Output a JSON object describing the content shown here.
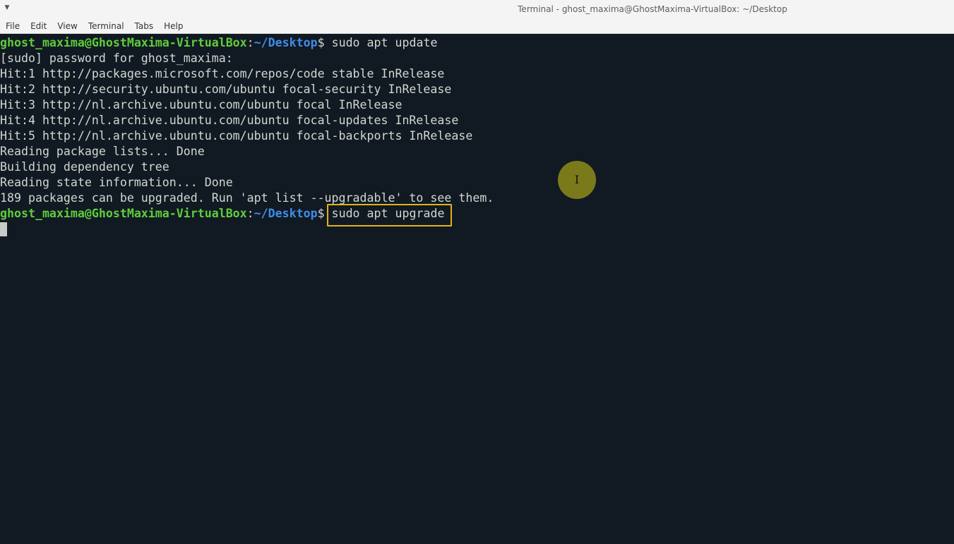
{
  "window": {
    "title": "Terminal - ghost_maxima@GhostMaxima-VirtualBox: ~/Desktop",
    "menu_icon": "chevron-down-icon"
  },
  "menubar": {
    "items": [
      "File",
      "Edit",
      "View",
      "Terminal",
      "Tabs",
      "Help"
    ]
  },
  "terminal": {
    "prompt": {
      "user_host": "ghost_maxima@GhostMaxima-VirtualBox",
      "sep": ":",
      "path": "~/Desktop",
      "dollar": "$"
    },
    "command1": " sudo apt update",
    "output": [
      "[sudo] password for ghost_maxima:",
      "Hit:1 http://packages.microsoft.com/repos/code stable InRelease",
      "Hit:2 http://security.ubuntu.com/ubuntu focal-security InRelease",
      "Hit:3 http://nl.archive.ubuntu.com/ubuntu focal InRelease",
      "Hit:4 http://nl.archive.ubuntu.com/ubuntu focal-updates InRelease",
      "Hit:5 http://nl.archive.ubuntu.com/ubuntu focal-backports InRelease",
      "Reading package lists... Done",
      "Building dependency tree",
      "Reading state information... Done",
      "189 packages can be upgraded. Run 'apt list --upgradable' to see them."
    ],
    "command2": " sudo apt upgrade",
    "highlight_color": "#e3b21b"
  },
  "colors": {
    "background": "#111923",
    "prompt_user": "#5fce3a",
    "prompt_path": "#3f8ee8",
    "text": "#d3d7cf",
    "mouse_indicator": "#7a7a1a"
  }
}
